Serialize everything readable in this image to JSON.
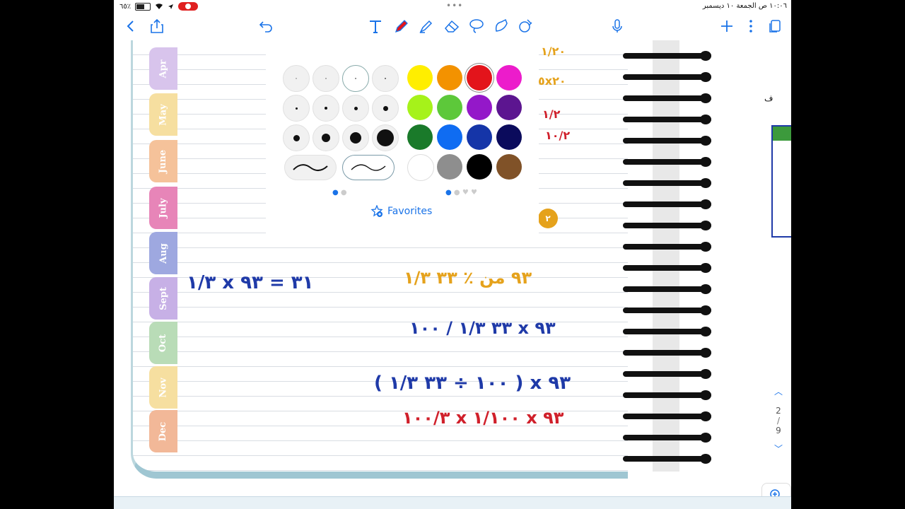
{
  "status_bar": {
    "battery": "٦٥٪",
    "battery_level": 0.65,
    "datetime": "١٠:٠٦ ص  الجمعة ١٠ ديسمبر",
    "multitask_dots": "•••"
  },
  "toolbar": {
    "icons": [
      "back-icon",
      "share-icon",
      "undo-icon",
      "text-icon",
      "pen-icon",
      "highlighter-icon",
      "eraser-icon",
      "lasso-icon",
      "shapes-icon",
      "sticker-icon",
      "microphone-icon",
      "add-icon",
      "more-icon",
      "pages-icon"
    ]
  },
  "notebook": {
    "month_tabs": [
      "Apr",
      "May",
      "June",
      "July",
      "Aug",
      "Sept",
      "Oct",
      "Nov",
      "Dec"
    ],
    "math_lines": [
      "٣١ = ٩٣ x ١/٣",
      "٩٣  من  ٪ ٣٣ ١/٣",
      "٩٣  x  ٣٣ ١/٣ / ١٠٠",
      "٩٣  x  ( ١٠٠ ÷ ٣٣ ١/٣ )",
      "٩٣  x  ١/١٠٠  x  ١٠٠/٣"
    ],
    "side_numbers": [
      "١/٢٠",
      "٥x٢٠",
      "١/٢",
      "١٠/٢",
      "٢"
    ],
    "right_label": "ف"
  },
  "palette": {
    "colors": [
      "#ffee00",
      "#f39200",
      "#e3141b",
      "#ec1ccb",
      "#a6f21a",
      "#5dc83a",
      "#9418c9",
      "#5c1590",
      "#1a7a2a",
      "#0f6cf2",
      "#1535a8",
      "#0b0b5c",
      "#ffffff",
      "#8e8e8e",
      "#000000",
      "#805228"
    ],
    "selected_color": "#e3141b",
    "favorites_label": "Favorites"
  },
  "pager": {
    "current": "2",
    "separator": "/",
    "total": "9"
  }
}
